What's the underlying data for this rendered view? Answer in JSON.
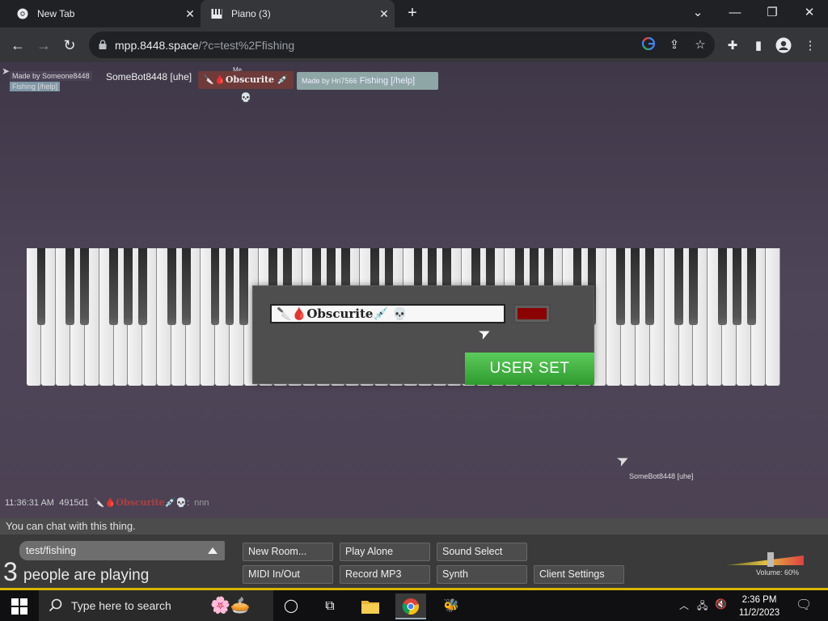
{
  "browser": {
    "tabs": [
      {
        "title": "New Tab",
        "icon": "chrome-icon"
      },
      {
        "title": "Piano (3)",
        "icon": "piano-icon",
        "active": true
      }
    ],
    "url_host": "mpp.8448.space",
    "url_path": "/?c=test%2Ffishing"
  },
  "page": {
    "nametags": {
      "made_by_1": "Made by Someone8448",
      "fishing_1": "Fishing [/help]",
      "somebot": "SomeBot8448 [uhe]",
      "me_label": "Me",
      "obscurite": "Obscurite",
      "made_by_2": "Made by Hri7566",
      "fishing_2": "Fishing [/help]"
    },
    "modal": {
      "name_value": "Obscurite",
      "name_color": "#8b0000",
      "submit_label": "USER SET"
    },
    "cursor_label": "SomeBot8448 [uhe]",
    "chat": {
      "time": "11:36:31 AM",
      "id": "4915d1",
      "user": "Obscurite",
      "sep": ":",
      "message": "nnn",
      "input_placeholder": "You can chat with this thing."
    },
    "room": {
      "name": "test/fishing",
      "count": "3",
      "count_text": "people are playing"
    },
    "buttons": {
      "new_room": "New Room...",
      "play_alone": "Play Alone",
      "sound_select": "Sound Select",
      "midi": "MIDI In/Out",
      "record": "Record MP3",
      "synth": "Synth",
      "client_settings": "Client Settings"
    },
    "volume": "Volume: 60%"
  },
  "taskbar": {
    "search_placeholder": "Type here to search",
    "time": "2:36 PM",
    "date": "11/2/2023"
  }
}
